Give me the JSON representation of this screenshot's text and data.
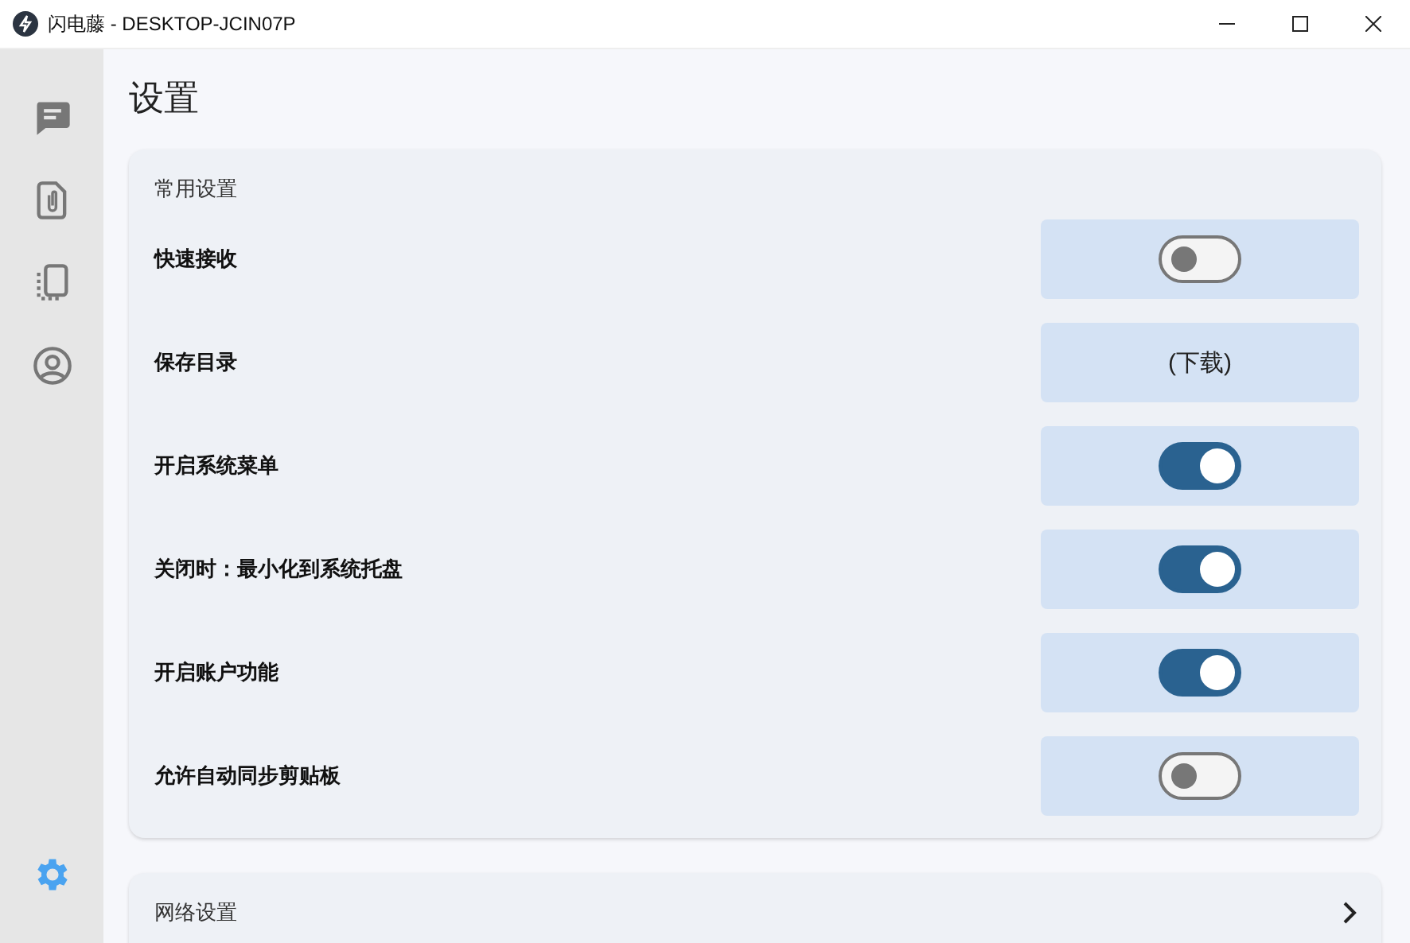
{
  "window": {
    "title": "闪电藤 - DESKTOP-JCIN07P"
  },
  "sidebar": {
    "items": [
      {
        "kind": "chat",
        "selected": false
      },
      {
        "kind": "file",
        "selected": false
      },
      {
        "kind": "clipboard",
        "selected": false
      },
      {
        "kind": "account",
        "selected": false
      }
    ],
    "settings": {
      "selected": true
    }
  },
  "page_title": "设置",
  "sections": [
    {
      "title": "常用设置",
      "expanded": true,
      "rows": [
        {
          "label": "快速接收",
          "kind": "toggle",
          "on": false
        },
        {
          "label": "保存目录",
          "kind": "value",
          "value": "(下载)"
        },
        {
          "label": "开启系统菜单",
          "kind": "toggle",
          "on": true
        },
        {
          "label": "关闭时：最小化到系统托盘",
          "kind": "toggle",
          "on": true
        },
        {
          "label": "开启账户功能",
          "kind": "toggle",
          "on": true
        },
        {
          "label": "允许自动同步剪贴板",
          "kind": "toggle",
          "on": false
        }
      ]
    },
    {
      "title": "网络设置",
      "expanded": false
    }
  ]
}
